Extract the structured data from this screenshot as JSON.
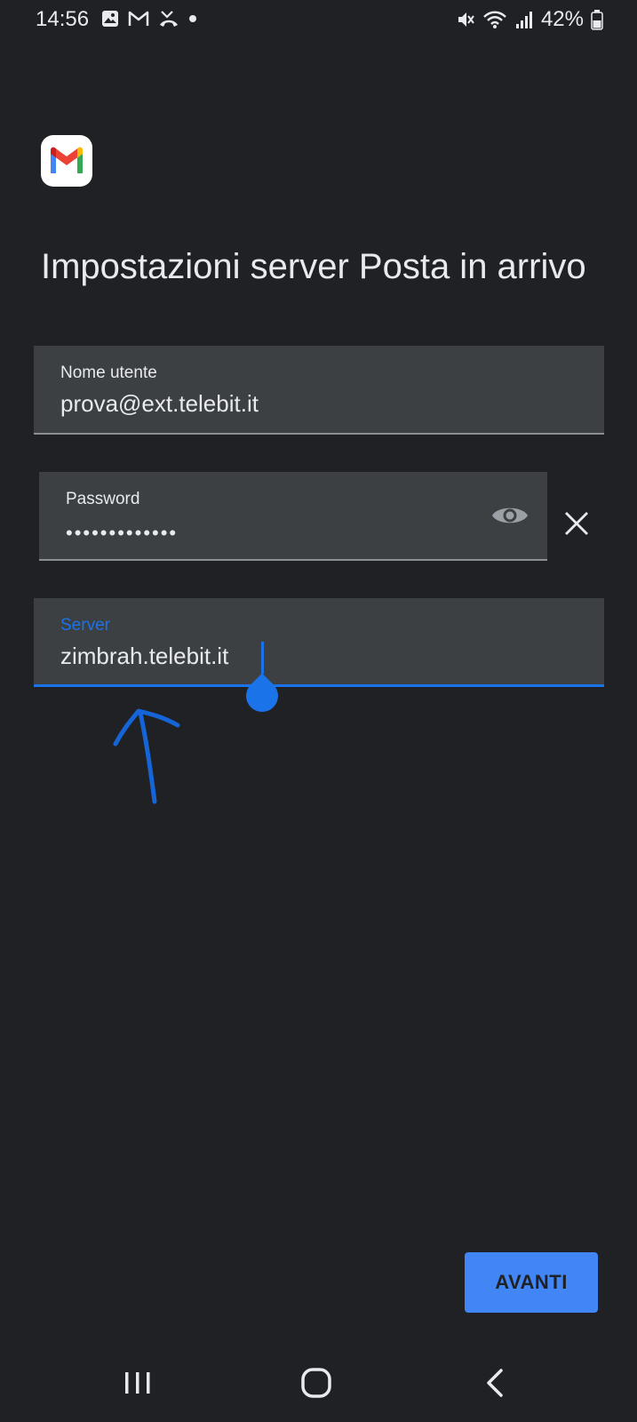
{
  "status_bar": {
    "time": "14:56",
    "battery": "42%",
    "left_icons": [
      "gallery-icon",
      "gmail-notification-icon",
      "missed-call-icon",
      "dot-icon"
    ],
    "right_icons": [
      "mute-icon",
      "wifi-icon",
      "signal-icon",
      "battery-icon"
    ]
  },
  "app": {
    "logo_icon": "gmail-logo-icon"
  },
  "page": {
    "title": "Impostazioni server Posta in arrivo"
  },
  "form": {
    "username": {
      "label": "Nome utente",
      "value": "prova@ext.telebit.it"
    },
    "password": {
      "label": "Password",
      "value": "•••••••••••••",
      "toggle_icon": "eye-icon",
      "clear_icon": "close-icon"
    },
    "server": {
      "label": "Server",
      "value": "zimbrah.telebit.it",
      "focused": true
    }
  },
  "actions": {
    "next_label": "AVANTI"
  },
  "nav": {
    "recents_icon": "recents-icon",
    "home_icon": "home-icon",
    "back_icon": "back-icon"
  },
  "colors": {
    "background": "#202124",
    "field_background": "#3c4043",
    "accent": "#1a73e8",
    "button": "#4285f4",
    "annotation": "#1565d8"
  }
}
